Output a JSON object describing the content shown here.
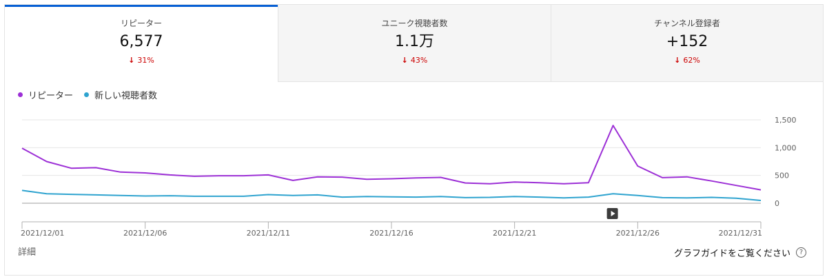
{
  "tabs": [
    {
      "label": "リピーター",
      "value": "6,577",
      "change": "31%",
      "direction": "down",
      "active": true
    },
    {
      "label": "ユニーク視聴者数",
      "value": "1.1万",
      "change": "43%",
      "direction": "down",
      "active": false
    },
    {
      "label": "チャンネル登録者",
      "value": "+152",
      "change": "62%",
      "direction": "down",
      "active": false
    }
  ],
  "legend": [
    {
      "name": "リピーター",
      "color": "#9c2fd6"
    },
    {
      "name": "新しい視聴者数",
      "color": "#2ea3cf"
    }
  ],
  "footer": {
    "details_label": "詳細",
    "guide_label": "グラフガイドをご覧ください",
    "help_icon": "?"
  },
  "colors": {
    "accent": "#065fd4",
    "down": "#cc0000"
  },
  "chart_data": {
    "type": "line",
    "x": [
      "2021/12/01",
      "2021/12/02",
      "2021/12/03",
      "2021/12/04",
      "2021/12/05",
      "2021/12/06",
      "2021/12/07",
      "2021/12/08",
      "2021/12/09",
      "2021/12/10",
      "2021/12/11",
      "2021/12/12",
      "2021/12/13",
      "2021/12/14",
      "2021/12/15",
      "2021/12/16",
      "2021/12/17",
      "2021/12/18",
      "2021/12/19",
      "2021/12/20",
      "2021/12/21",
      "2021/12/22",
      "2021/12/23",
      "2021/12/24",
      "2021/12/25",
      "2021/12/26",
      "2021/12/27",
      "2021/12/28",
      "2021/12/29",
      "2021/12/30",
      "2021/12/31"
    ],
    "tick_labels": [
      "2021/12/01",
      "2021/12/06",
      "2021/12/11",
      "2021/12/16",
      "2021/12/21",
      "2021/12/26",
      "2021/12/31"
    ],
    "series": [
      {
        "name": "リピーター",
        "color": "#9c2fd6",
        "values": [
          990,
          750,
          630,
          640,
          560,
          545,
          510,
          485,
          495,
          495,
          510,
          410,
          475,
          470,
          430,
          440,
          455,
          465,
          365,
          350,
          380,
          370,
          350,
          370,
          1400,
          670,
          460,
          475,
          400,
          320,
          240
        ]
      },
      {
        "name": "新しい視聴者数",
        "color": "#2ea3cf",
        "values": [
          230,
          170,
          160,
          150,
          140,
          130,
          135,
          125,
          125,
          125,
          155,
          140,
          150,
          110,
          120,
          115,
          110,
          120,
          100,
          105,
          120,
          110,
          95,
          110,
          170,
          140,
          100,
          95,
          105,
          90,
          50
        ]
      }
    ],
    "y_ticks": [
      "1,500",
      "1,000",
      "500",
      "0"
    ],
    "ylim": [
      0,
      1500
    ],
    "grid": true,
    "legend_position": "top-left",
    "marker_icon": "play-icon",
    "marker_date": "2021/12/25"
  }
}
